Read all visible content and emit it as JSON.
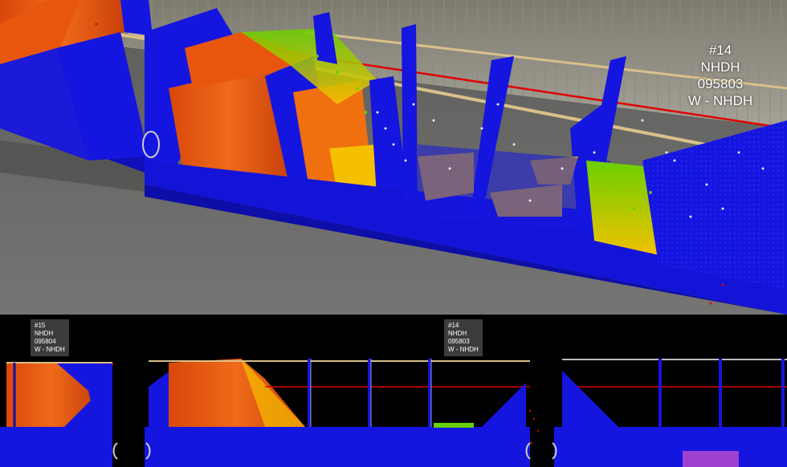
{
  "viewport": {
    "car_label": {
      "number": "#14",
      "line2": "NHDH",
      "line3": "095803",
      "line4": "W - NHDH"
    }
  },
  "profile_view": {
    "tags": [
      {
        "number": "#15",
        "line2": "NHDH",
        "line3": "095804",
        "line4": "W - NHDH"
      },
      {
        "number": "#14",
        "line2": "NHDH",
        "line3": "095803",
        "line4": "W - NHDH"
      }
    ]
  },
  "colors": {
    "car_body": "#1515e0",
    "load_high": "#e8560e",
    "load_mid": "#f5c000",
    "load_low": "#6ad000",
    "ground": "#6e6e6c",
    "wall": "#9a978c",
    "rail_line": "#d9c08a",
    "red_line": "#e00000"
  }
}
